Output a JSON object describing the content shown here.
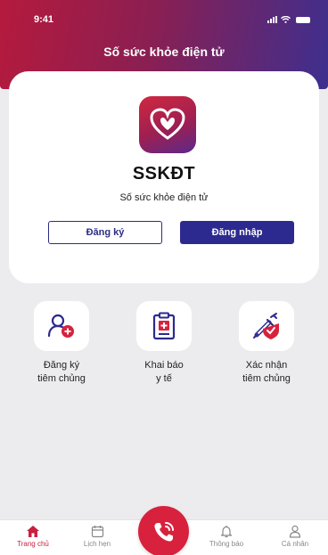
{
  "status_bar": {
    "time": "9:41"
  },
  "header": {
    "title": "Số sức khỏe điện tử"
  },
  "app": {
    "name": "SSKĐT",
    "subtitle": "Số sức khỏe điện tử",
    "register_label": "Đăng ký",
    "login_label": "Đăng nhập"
  },
  "features": [
    {
      "label": "Đăng ký\ntiêm chủng",
      "icon": "add-user-icon"
    },
    {
      "label": "Khai báo\ny tế",
      "icon": "medical-clipboard-icon"
    },
    {
      "label": "Xác nhận\ntiêm chủng",
      "icon": "syringe-shield-icon"
    }
  ],
  "bottom_nav": {
    "items": [
      {
        "label": "Trang chủ",
        "icon": "home-icon",
        "active": true
      },
      {
        "label": "Lịch hẹn",
        "icon": "calendar-icon",
        "active": false
      },
      {
        "label": "Thông báo",
        "icon": "bell-icon",
        "active": false
      },
      {
        "label": "Cá nhân",
        "icon": "person-icon",
        "active": false
      }
    ],
    "call_icon": "phone-icon"
  },
  "colors": {
    "brand_red": "#d8213d",
    "brand_indigo": "#2c2a8e",
    "background": "#ececee"
  }
}
